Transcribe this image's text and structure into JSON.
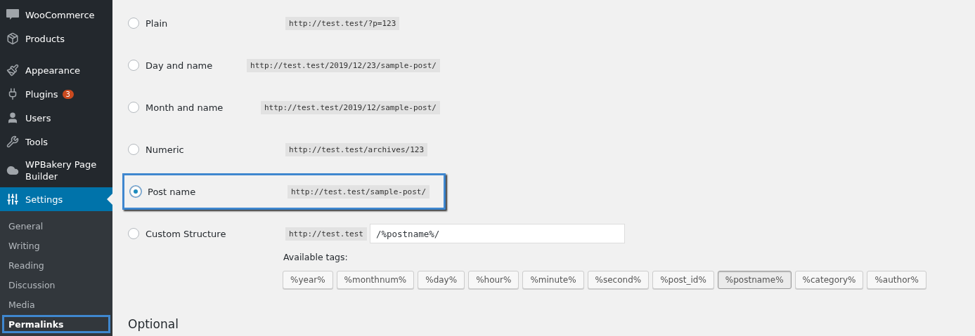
{
  "sidebar": {
    "items": [
      {
        "label": "WooCommerce",
        "kind": "woo",
        "selected": false
      },
      {
        "label": "Products",
        "kind": "package",
        "selected": false
      },
      {
        "label": "Appearance",
        "kind": "brush",
        "selected": false
      },
      {
        "label": "Plugins",
        "kind": "plug",
        "selected": false,
        "badge": "3"
      },
      {
        "label": "Users",
        "kind": "user",
        "selected": false
      },
      {
        "label": "Tools",
        "kind": "wrench",
        "selected": false
      },
      {
        "label": "WPBakery Page Builder",
        "kind": "cloud",
        "selected": false
      },
      {
        "label": "Settings",
        "kind": "sliders",
        "selected": true
      }
    ],
    "submenu": [
      {
        "label": "General",
        "selected": false,
        "highlighted": false
      },
      {
        "label": "Writing",
        "selected": false,
        "highlighted": false
      },
      {
        "label": "Reading",
        "selected": false,
        "highlighted": false
      },
      {
        "label": "Discussion",
        "selected": false,
        "highlighted": false
      },
      {
        "label": "Media",
        "selected": false,
        "highlighted": false
      },
      {
        "label": "Permalinks",
        "selected": true,
        "highlighted": true
      }
    ]
  },
  "options": [
    {
      "label": "Plain",
      "example": "http://test.test/?p=123",
      "selected": false,
      "highlighted": false
    },
    {
      "label": "Day and name",
      "example": "http://test.test/2019/12/23/sample-post/",
      "selected": false,
      "highlighted": false
    },
    {
      "label": "Month and name",
      "example": "http://test.test/2019/12/sample-post/",
      "selected": false,
      "highlighted": false
    },
    {
      "label": "Numeric",
      "example": "http://test.test/archives/123",
      "selected": false,
      "highlighted": false
    },
    {
      "label": "Post name",
      "example": "http://test.test/sample-post/",
      "selected": true,
      "highlighted": true
    }
  ],
  "custom": {
    "label": "Custom Structure",
    "selected": false,
    "prefix": "http://test.test",
    "value": "/%postname%/",
    "tags_label": "Available tags:",
    "tags": [
      {
        "label": "%year%",
        "selected": false
      },
      {
        "label": "%monthnum%",
        "selected": false
      },
      {
        "label": "%day%",
        "selected": false
      },
      {
        "label": "%hour%",
        "selected": false
      },
      {
        "label": "%minute%",
        "selected": false
      },
      {
        "label": "%second%",
        "selected": false
      },
      {
        "label": "%post_id%",
        "selected": false
      },
      {
        "label": "%postname%",
        "selected": true
      },
      {
        "label": "%category%",
        "selected": false
      },
      {
        "label": "%author%",
        "selected": false
      }
    ]
  },
  "optional": {
    "heading": "Optional"
  }
}
